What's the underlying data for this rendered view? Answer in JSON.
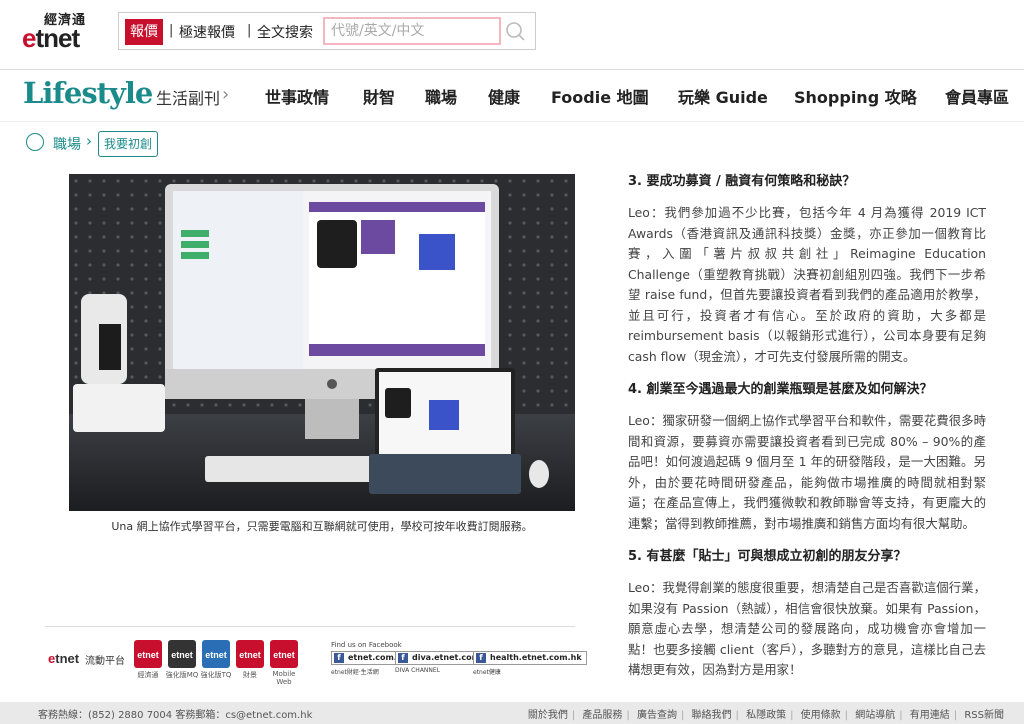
{
  "header": {
    "logo_zh": "經濟通",
    "logo_e": "e",
    "logo_rest": "tnet",
    "tabs": [
      "報價",
      "極速報價",
      "全文搜索"
    ],
    "search_placeholder": "代號/英文/中文"
  },
  "nav": {
    "brand": "Lifestyle",
    "brand_sub": "生活副刊",
    "items": [
      "世事政情",
      "財智",
      "職場",
      "健康",
      "Foodie 地圖",
      "玩樂 Guide",
      "Shopping 攻略",
      "會員專區"
    ]
  },
  "breadcrumb": {
    "section": "職場",
    "tag": "我要初創"
  },
  "photo": {
    "caption": "Una 網上協作式學習平台，只需要電腦和互聯網就可使用，學校可按年收費訂閱服務。"
  },
  "article": {
    "q3": "3. 要成功募資 / 融資有何策略和秘訣？",
    "a3": "Leo：我們參加過不少比賽，包括今年 4 月為獲得 2019 ICT Awards（香港資訊及通訊科技獎）金獎，亦正參加一個教育比賽，入圍「薯片叔叔共創社」Reimagine Education Challenge（重塑教育挑戰）決賽初創組別四強。我們下一步希望 raise fund，但首先要讓投資者看到我們的產品適用於教學，並且可行，投資者才有信心。至於政府的資助，大多都是 reimbursement basis（以報銷形式進行），公司本身要有足夠 cash flow（現金流），才可先支付發展所需的開支。",
    "q4": "4. 創業至今遇過最大的創業瓶頸是甚麼及如何解決？",
    "a4": "Leo：獨家研發一個網上協作式學習平台和軟件，需要花費很多時間和資源，要募資亦需要讓投資者看到已完成 80% – 90%的產品吧！如何渡過起碼 9 個月至 1 年的研發階段，是一大困難。另外，由於要花時間研發產品，能夠做市場推廣的時間就相對緊逼；在產品宣傳上，我們獲微軟和教師聯會等支持，有更龐大的連繫；當得到教師推薦，對市場推廣和銷售方面均有很大幫助。",
    "q5": "5. 有甚麼「貼士」可與想成立初創的朋友分享？",
    "a5": "Leo：我覺得創業的態度很重要，想清楚自己是否喜歡這個行業，如果沒有 Passion（熱誠），相信會很快放棄。如果有 Passion，願意虛心去學，想清楚公司的發展路向，成功機會亦會增加一點！也要多接觸 client（客戶），多聽對方的意見，這樣比自己去構想更有效，因為對方是用家！"
  },
  "footer_apps": {
    "platform_label": "流動平台",
    "apps": [
      {
        "icon": "etnet",
        "label": "經濟通",
        "color": "#c8102e"
      },
      {
        "icon": "etnet",
        "label": "強化版MQ",
        "color": "#333333"
      },
      {
        "icon": "etnet",
        "label": "強化版TQ",
        "color": "#2a6fb5"
      },
      {
        "icon": "etnet",
        "label": "財景",
        "color": "#c8102e"
      },
      {
        "icon": "etnet",
        "label": "Mobile Web",
        "color": "#c8102e"
      }
    ],
    "fb_title": "Find us on Facebook",
    "fb_links": [
      {
        "label": "etnet.com.hk",
        "sub": "etnet財經‧生活網"
      },
      {
        "label": "diva.etnet.com.hk",
        "sub": "DIVA CHANNEL"
      },
      {
        "label": "health.etnet.com.hk",
        "sub": "etnet健康"
      }
    ]
  },
  "bottom": {
    "hotline": "客務熱線：(852) 2880 7004   客務郵箱：cs@etnet.com.hk",
    "links": [
      "關於我們",
      "產品服務",
      "廣告查詢",
      "聯絡我們",
      "私隱政策",
      "使用條款",
      "網站導航",
      "有用連結",
      "RSS新聞"
    ]
  },
  "colors": {
    "brand_red": "#c8102e",
    "lifestyle_teal": "#1a8b8a"
  }
}
